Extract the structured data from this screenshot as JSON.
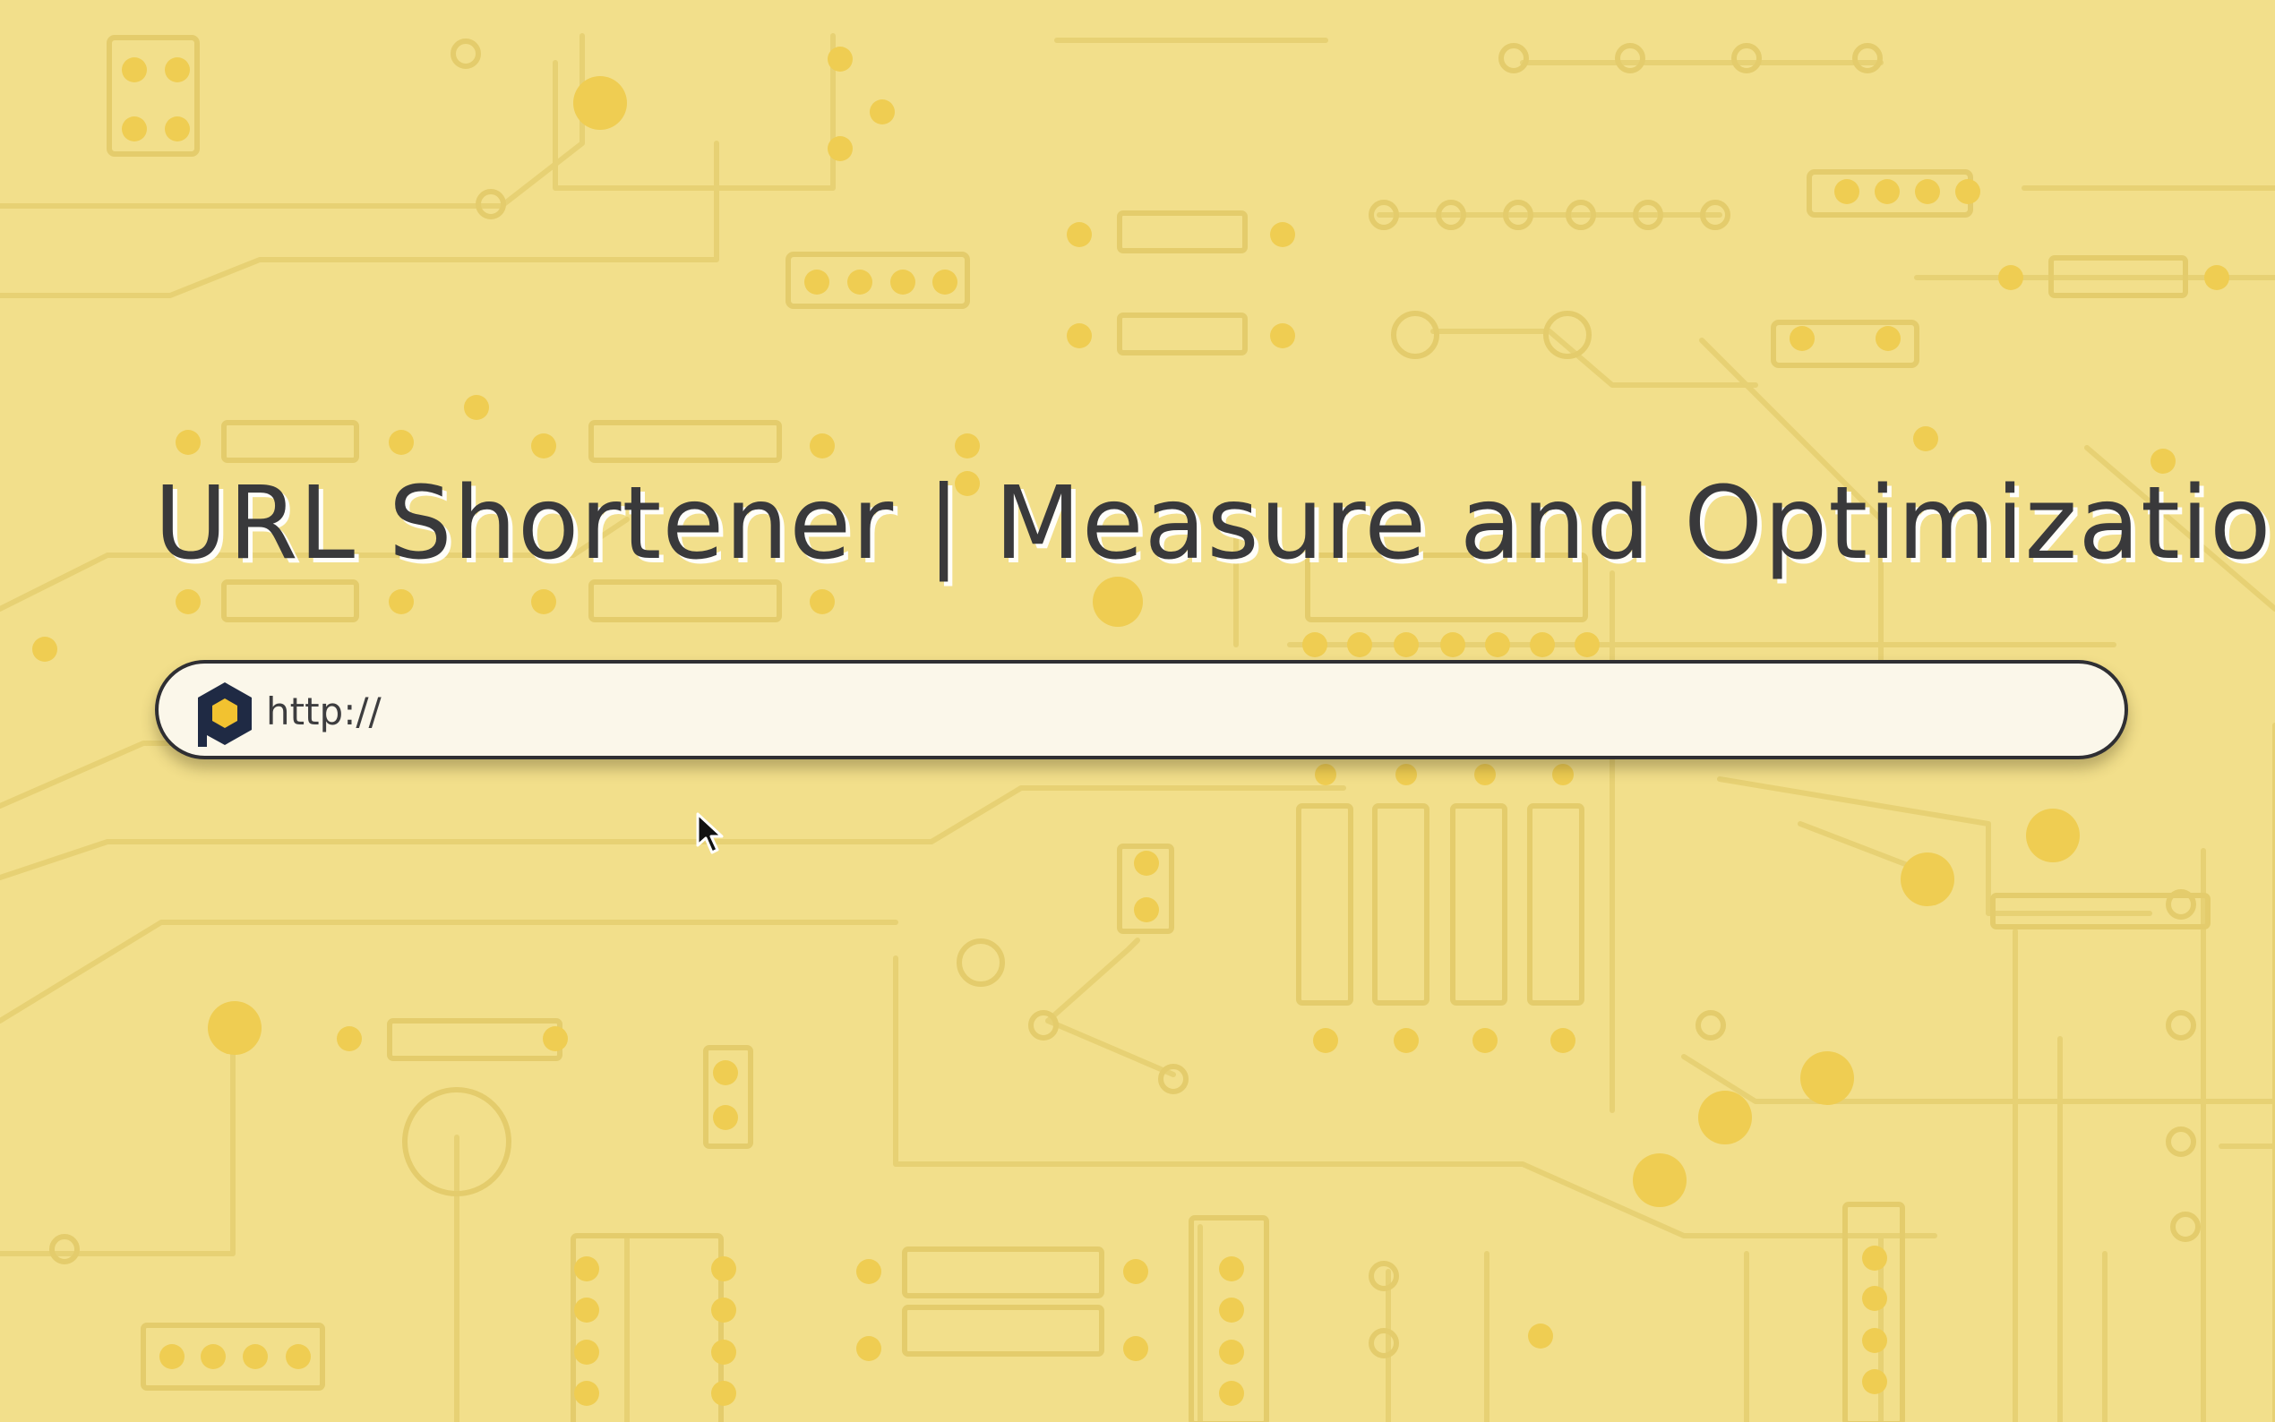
{
  "page": {
    "title": "URL Shortener | Measure and Optimization"
  },
  "url_bar": {
    "placeholder": "http://",
    "value": "",
    "brand_icon": "hexagon-logo-icon"
  },
  "colors": {
    "background": "#f2df8b",
    "circuit_trace": "#e6cf70",
    "circuit_pad": "#ecc94e",
    "title_text": "#39393b",
    "input_fill": "#fbf7ea",
    "input_border": "#2f2f33",
    "logo_dark": "#1f2a44",
    "logo_accent": "#f2c230"
  },
  "pointer": {
    "icon": "mouse-pointer-icon"
  }
}
